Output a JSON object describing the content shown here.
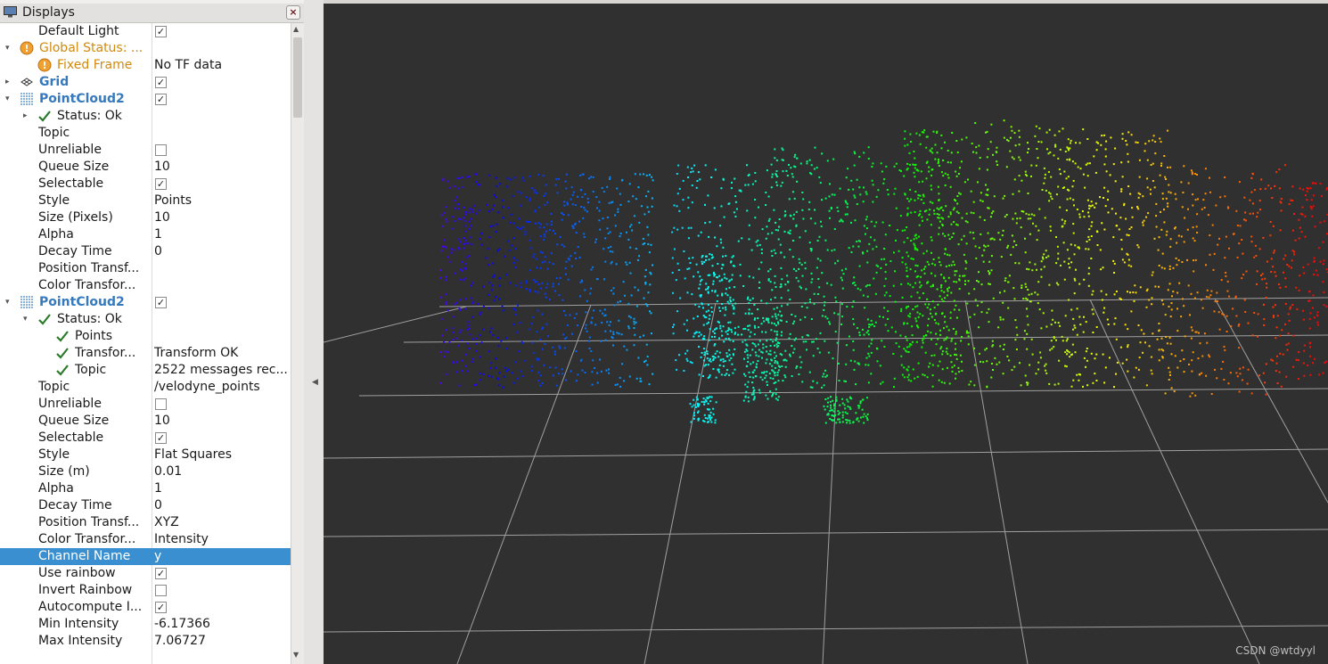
{
  "panel": {
    "title": "Displays",
    "close_label": "×"
  },
  "rows": [
    {
      "label": "Default Light",
      "value": "",
      "checkbox": true,
      "checked": true
    },
    {
      "label": "Global Status: ...",
      "value": "",
      "icon": "warning-icon",
      "style": "warn",
      "expand": "down"
    },
    {
      "label": "Fixed Frame",
      "value": "No TF data",
      "icon": "warning-icon",
      "style": "warn"
    },
    {
      "label": "Grid",
      "value": "",
      "icon": "grid-icon",
      "style": "bold-blue",
      "expand": "right",
      "checkbox": true,
      "checked": true
    },
    {
      "label": "PointCloud2",
      "value": "",
      "icon": "pointcloud-icon",
      "style": "bold-blue",
      "expand": "down",
      "checkbox": true,
      "checked": true
    },
    {
      "label": "Status: Ok",
      "value": "",
      "icon": "check-icon",
      "expand": "right"
    },
    {
      "label": "Topic",
      "value": ""
    },
    {
      "label": "Unreliable",
      "value": "",
      "checkbox": true,
      "checked": false
    },
    {
      "label": "Queue Size",
      "value": "10"
    },
    {
      "label": "Selectable",
      "value": "",
      "checkbox": true,
      "checked": true
    },
    {
      "label": "Style",
      "value": "Points"
    },
    {
      "label": "Size (Pixels)",
      "value": "10"
    },
    {
      "label": "Alpha",
      "value": "1"
    },
    {
      "label": "Decay Time",
      "value": "0"
    },
    {
      "label": "Position Transf...",
      "value": ""
    },
    {
      "label": "Color Transfor...",
      "value": ""
    },
    {
      "label": "PointCloud2",
      "value": "",
      "icon": "pointcloud-icon",
      "style": "bold-blue",
      "expand": "down",
      "checkbox": true,
      "checked": true
    },
    {
      "label": "Status: Ok",
      "value": "",
      "icon": "check-icon",
      "expand": "down"
    },
    {
      "label": "Points",
      "value": "",
      "icon": "check-icon"
    },
    {
      "label": "Transfor...",
      "value": "Transform OK",
      "icon": "check-icon"
    },
    {
      "label": "Topic",
      "value": "2522 messages rec...",
      "icon": "check-icon"
    },
    {
      "label": "Topic",
      "value": "/velodyne_points"
    },
    {
      "label": "Unreliable",
      "value": "",
      "checkbox": true,
      "checked": false
    },
    {
      "label": "Queue Size",
      "value": "10"
    },
    {
      "label": "Selectable",
      "value": "",
      "checkbox": true,
      "checked": true
    },
    {
      "label": "Style",
      "value": "Flat Squares"
    },
    {
      "label": "Size (m)",
      "value": "0.01"
    },
    {
      "label": "Alpha",
      "value": "1"
    },
    {
      "label": "Decay Time",
      "value": "0"
    },
    {
      "label": "Position Transf...",
      "value": "XYZ"
    },
    {
      "label": "Color Transfor...",
      "value": "Intensity"
    },
    {
      "label": "Channel Name",
      "value": "y",
      "selected": true
    },
    {
      "label": "Use rainbow",
      "value": "",
      "checkbox": true,
      "checked": true
    },
    {
      "label": "Invert Rainbow",
      "value": "",
      "checkbox": true,
      "checked": false
    },
    {
      "label": "Autocompute I...",
      "value": "",
      "checkbox": true,
      "checked": true
    },
    {
      "label": "Min Intensity",
      "value": "-6.17366"
    },
    {
      "label": "Max Intensity",
      "value": "7.06727"
    }
  ],
  "viewport": {
    "watermark": "CSDN @wtdyyl",
    "background": "#303030",
    "grid_color": "#a0a0a0"
  }
}
